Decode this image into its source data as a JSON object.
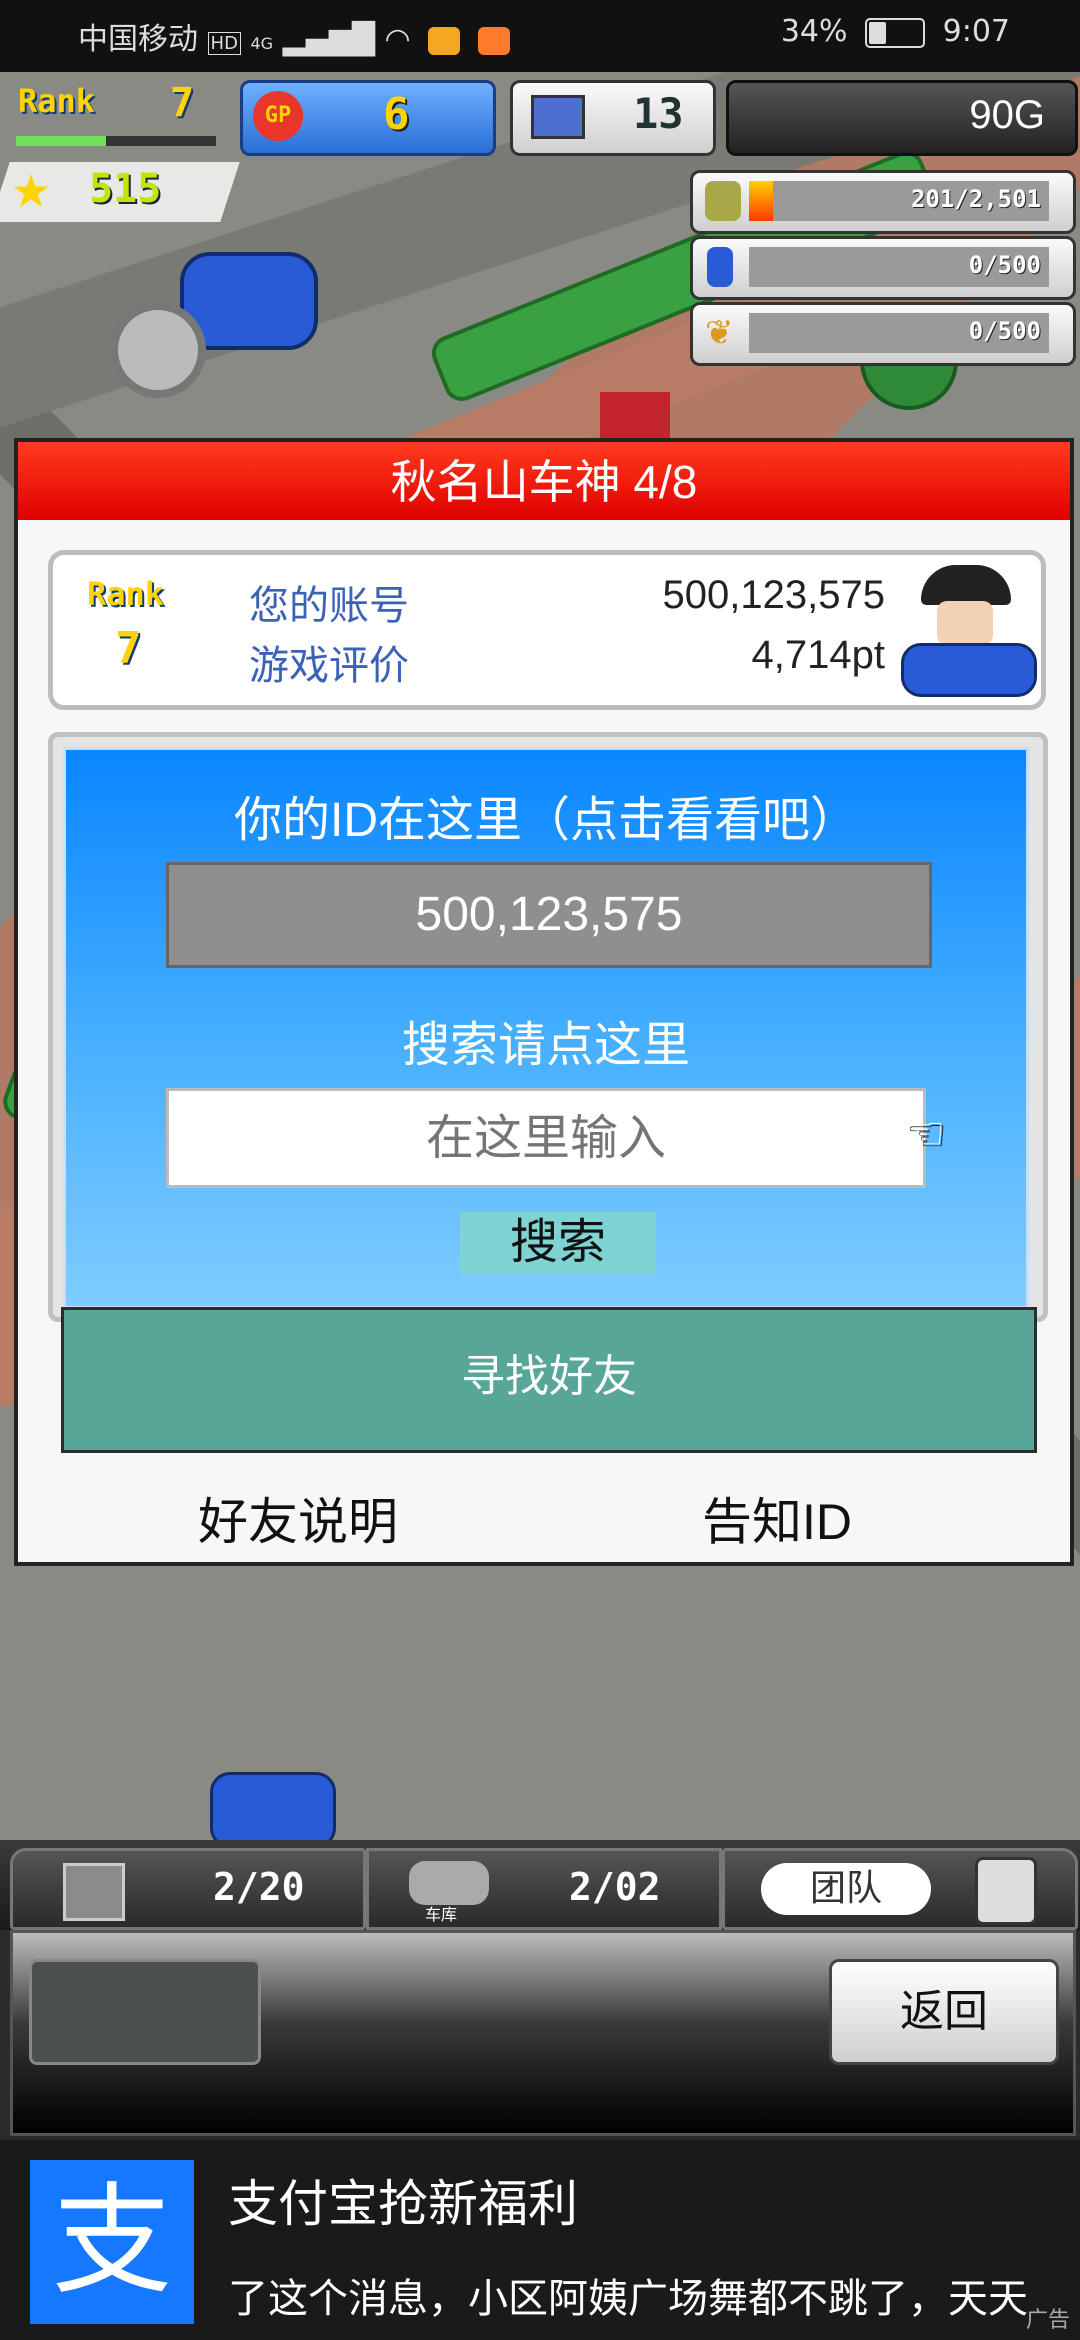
{
  "status_bar": {
    "carrier": "中国移动",
    "hd": "HD",
    "network": "4G",
    "battery": "34%",
    "time": "9:07"
  },
  "hud": {
    "rank_label": "Rank",
    "rank_value": "7",
    "gp_label": "GP",
    "gp_value": "6",
    "computer_value": "13",
    "gold": "90G",
    "stars": "515",
    "resources": [
      {
        "name": "coins",
        "value": "201/2,501"
      },
      {
        "name": "fuel",
        "value": "0/500"
      },
      {
        "name": "wheat",
        "value": "0/500"
      }
    ]
  },
  "dialog": {
    "title": "秋名山车神 4/8",
    "rank_label": "Rank",
    "rank_value": "7",
    "account_label": "您的账号",
    "account_value": "500,123,575",
    "rating_label": "游戏评价",
    "rating_value": "4,714pt",
    "id_heading": "你的ID在这里（点击看看吧）",
    "id_value": "500,123,575",
    "search_heading": "搜索请点这里",
    "search_placeholder": "在这里输入",
    "search_button": "搜索",
    "find_friends": "寻找好友",
    "friend_help": "好友说明",
    "tell_id": "告知ID"
  },
  "bottom_bar": {
    "slot1": "2/20",
    "garage_label": "车库",
    "slot2": "2/02",
    "team_label": "团队",
    "back_button": "返回"
  },
  "ad": {
    "logo_char": "支",
    "title": "支付宝抢新福利",
    "text": "了这个消息，小区阿姨广场舞都不跳了，天天",
    "tag": "广告"
  },
  "colors": {
    "title_red": "#e00000",
    "find_green": "#57a697",
    "panel_blue": "#0a86ff",
    "alipay_blue": "#1677ff"
  }
}
